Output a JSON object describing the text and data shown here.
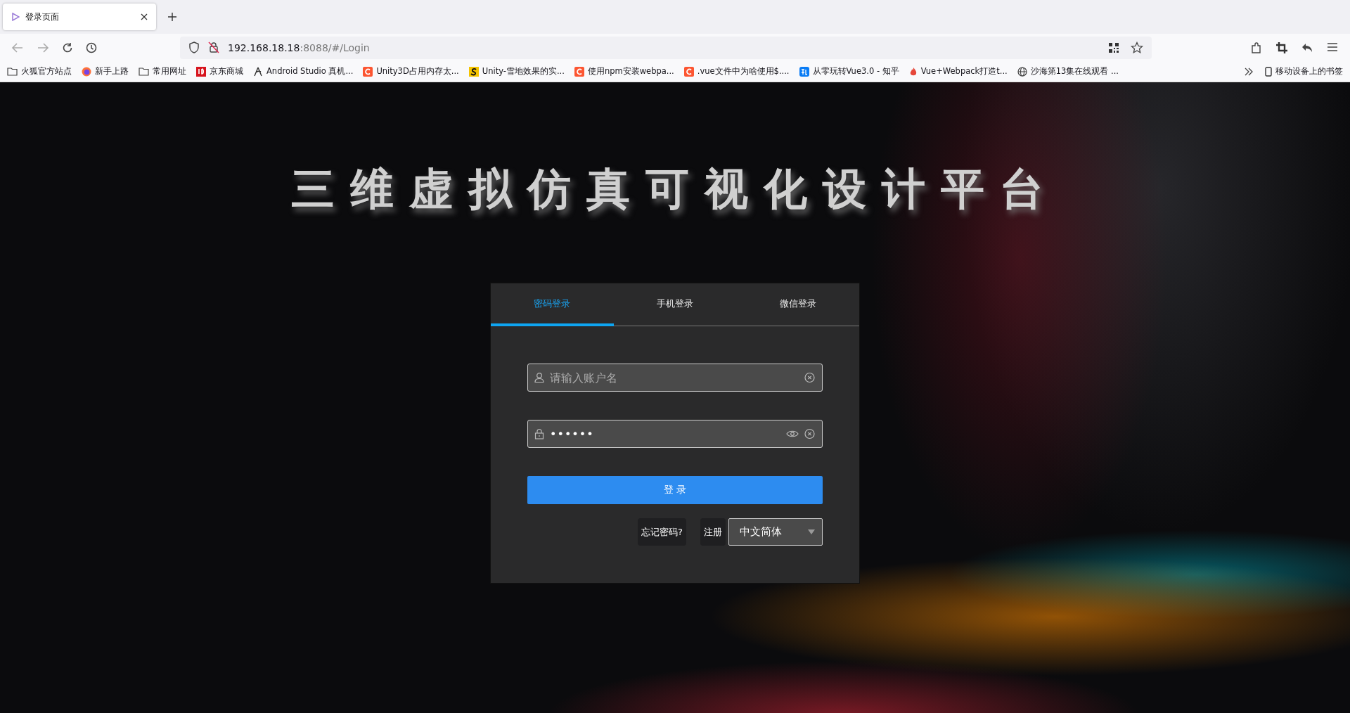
{
  "browser": {
    "tabs": [
      {
        "title": "登录页面",
        "selected": true
      }
    ],
    "address": {
      "host": "192.168.18.18",
      "rest": ":8088/#/Login"
    },
    "bookmarks": [
      {
        "label": "火狐官方站点",
        "kind": "folder"
      },
      {
        "label": "新手上路",
        "kind": "site"
      },
      {
        "label": "常用网址",
        "kind": "folder"
      },
      {
        "label": "京东商城",
        "kind": "site"
      },
      {
        "label": "Android Studio 真机...",
        "kind": "site"
      },
      {
        "label": "Unity3D占用内存太...",
        "kind": "site"
      },
      {
        "label": "Unity-雪地效果的实...",
        "kind": "site"
      },
      {
        "label": "使用npm安装webpa...",
        "kind": "site"
      },
      {
        "label": ".vue文件中为啥使用$....",
        "kind": "site"
      },
      {
        "label": "从零玩转Vue3.0 - 知乎",
        "kind": "site"
      },
      {
        "label": "Vue+Webpack打造t...",
        "kind": "site"
      },
      {
        "label": "沙海第13集在线观看 ...",
        "kind": "site"
      }
    ],
    "mobile_bookmarks": "移动设备上的书签"
  },
  "page": {
    "title": "三维虚拟仿真可视化设计平台",
    "login": {
      "tabs": [
        {
          "label": "密码登录",
          "selected": true
        },
        {
          "label": "手机登录",
          "selected": false
        },
        {
          "label": "微信登录",
          "selected": false
        }
      ],
      "username": {
        "placeholder": "请输入账户名"
      },
      "password": {
        "value": "••••••"
      },
      "submit": "登 录",
      "forgot": "忘记密码?",
      "register": "注册",
      "language": "中文简体"
    }
  }
}
